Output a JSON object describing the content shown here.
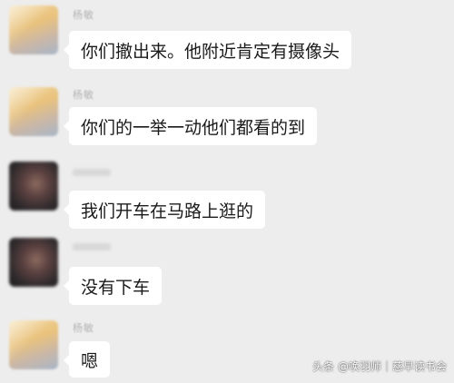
{
  "messages": [
    {
      "sender": "杨敏",
      "text": "你们撤出来。他附近肯定有摄像头"
    },
    {
      "sender": "杨敏",
      "text": "你们的一举一动他们都看的到"
    },
    {
      "sender": "",
      "text": "我们开车在马路上逛的"
    },
    {
      "sender": "",
      "text": "没有下车"
    },
    {
      "sender": "杨敏",
      "text": "嗯"
    }
  ],
  "watermark": "头条 @唤羽师｜慈早读书会"
}
